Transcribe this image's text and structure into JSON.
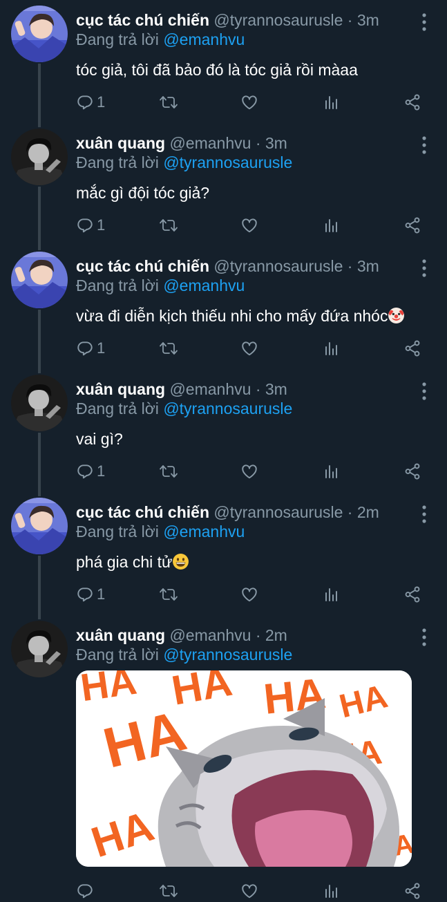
{
  "tweets": [
    {
      "name": "cục tác chú chiến",
      "handle": "@tyrannosaurusle",
      "dot": "·",
      "time": "3m",
      "replying_prefix": "Đang trả lời",
      "replying_to": "@emanhvu",
      "text": "tóc giả, tôi đã bảo đó là tóc giả rồi màaa",
      "reply_count": "1",
      "avatar_theme": "blue"
    },
    {
      "name": "xuân quang",
      "handle": "@emanhvu",
      "dot": "·",
      "time": "3m",
      "replying_prefix": "Đang trả lời",
      "replying_to": "@tyrannosaurusle",
      "text": "mắc gì đội tóc giả?",
      "reply_count": "1",
      "avatar_theme": "dark"
    },
    {
      "name": "cục tác chú chiến",
      "handle": "@tyrannosaurusle",
      "dot": "·",
      "time": "3m",
      "replying_prefix": "Đang trả lời",
      "replying_to": "@emanhvu",
      "text": "vừa đi diễn kịch thiếu nhi cho mấy đứa nhóc",
      "emoji": "clown-face-emoji",
      "reply_count": "1",
      "avatar_theme": "blue"
    },
    {
      "name": "xuân quang",
      "handle": "@emanhvu",
      "dot": "·",
      "time": "3m",
      "replying_prefix": "Đang trả lời",
      "replying_to": "@tyrannosaurusle",
      "text": "vai gì?",
      "reply_count": "1",
      "avatar_theme": "dark"
    },
    {
      "name": "cục tác chú chiến",
      "handle": "@tyrannosaurusle",
      "dot": "·",
      "time": "2m",
      "replying_prefix": "Đang trả lời",
      "replying_to": "@emanhvu",
      "text": "phá gia chi tử",
      "emoji": "grinning-face-emoji",
      "reply_count": "1",
      "avatar_theme": "blue"
    },
    {
      "name": "xuân quang",
      "handle": "@emanhvu",
      "dot": "·",
      "time": "2m",
      "replying_prefix": "Đang trả lời",
      "replying_to": "@tyrannosaurusle",
      "media": {
        "type": "image",
        "description_icon": "laughing-cat-meme",
        "overlay_text": [
          "HA",
          "HA",
          "HA",
          "HA",
          "HA",
          "HA",
          "HA",
          "HA"
        ]
      },
      "reply_count": "",
      "avatar_theme": "dark"
    }
  ],
  "colors": {
    "background": "#15202b",
    "text": "#ffffff",
    "muted": "#8899a6",
    "link": "#1da1f2",
    "thread_line": "#38444d",
    "meme_text": "#f26522"
  },
  "icons": {
    "reply": "reply-icon",
    "retweet": "retweet-icon",
    "like": "heart-icon",
    "analytics": "analytics-icon",
    "share": "share-icon",
    "more": "more-vertical-icon"
  }
}
